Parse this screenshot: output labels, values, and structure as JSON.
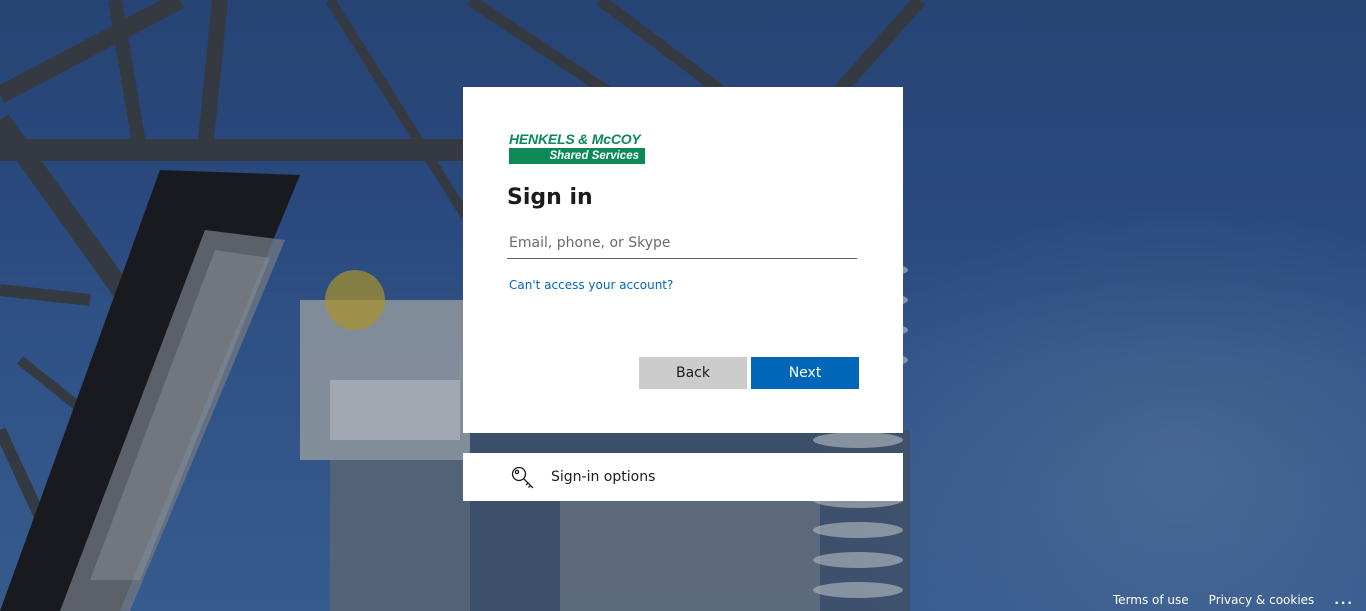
{
  "brand": {
    "line1": "HENKELS & McCOY",
    "line2": "Shared Services",
    "color": "#0c8a55"
  },
  "signin": {
    "title": "Sign in",
    "email_placeholder": "Email, phone, or Skype",
    "email_value": "",
    "cant_access": "Can't access your account?",
    "back_label": "Back",
    "next_label": "Next"
  },
  "options": {
    "label": "Sign-in options",
    "icon": "key-icon"
  },
  "footer": {
    "terms": "Terms of use",
    "privacy": "Privacy & cookies",
    "more": "..."
  },
  "colors": {
    "accent": "#0067b8",
    "back_button": "#cccccc",
    "background": "#2e5089"
  }
}
